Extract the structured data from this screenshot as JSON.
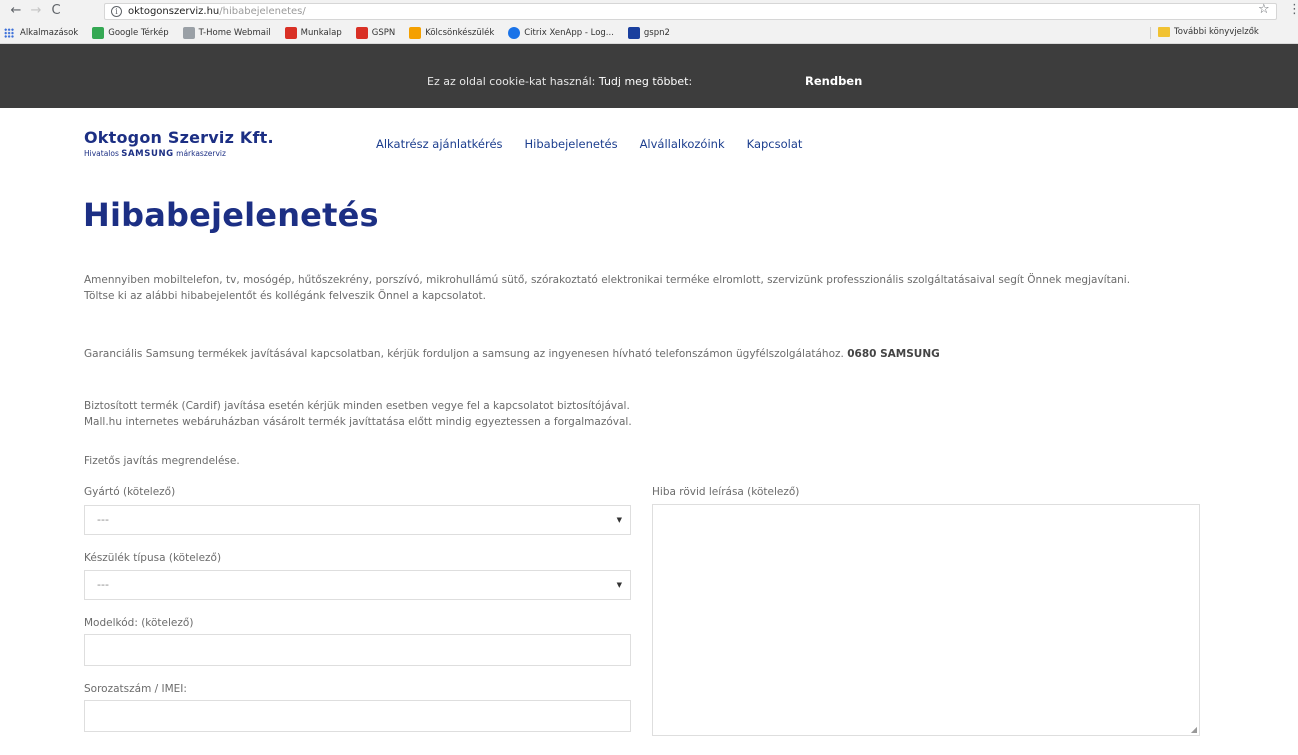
{
  "browser": {
    "back_glyph": "←",
    "forward_glyph": "→",
    "reload_glyph": "C",
    "info_glyph": "i",
    "url_domain": "oktogonszerviz.hu",
    "url_path": "/hibabejelenetes/",
    "star_glyph": "☆",
    "menu_glyph": "⋮",
    "bookmarks": [
      {
        "label": "Alkalmazások",
        "icon": "apps-icon",
        "color": "#3b6fd8"
      },
      {
        "label": "Google Térkép",
        "icon": "maps-icon",
        "color": "#34a853"
      },
      {
        "label": "T-Home Webmail",
        "icon": "thome-icon",
        "color": "#9aa0a6"
      },
      {
        "label": "Munkalap",
        "icon": "munkalap-icon",
        "color": "#d93025"
      },
      {
        "label": "GSPN",
        "icon": "gspn-icon",
        "color": "#d93025"
      },
      {
        "label": "Kölcsönkészülék",
        "icon": "kolcson-icon",
        "color": "#f4a000"
      },
      {
        "label": "Citrix XenApp - Log...",
        "icon": "citrix-icon",
        "color": "#1a73e8"
      },
      {
        "label": "gspn2",
        "icon": "s-icon",
        "color": "#1a3f9e"
      }
    ],
    "more_bookmarks": "További könyvjelzők"
  },
  "cookie_bar": {
    "text": "Ez az oldal cookie-kat használ:",
    "more": "Tudj meg többet",
    "ok": "Rendben"
  },
  "site": {
    "brand_title": "Oktogon Szerviz Kft.",
    "brand_sub_pre": "Hivatalos",
    "brand_sub_brand": "SAMSUNG",
    "brand_sub_post": "márkaszerviz",
    "nav": [
      {
        "label": "Alkatrész ajánlatkérés"
      },
      {
        "label": "Hibabejelenetés"
      },
      {
        "label": "Alvállalkozóink"
      },
      {
        "label": "Kapcsolat"
      }
    ]
  },
  "page": {
    "title": "Hibabejelenetés",
    "intro_1": "Amennyiben mobiltelefon, tv, mosógép, hűtőszekrény, porszívó, mikrohullámú sütő, szórakoztató elektronikai terméke elromlott, szervizünk professzionális szolgáltatásaival segít Önnek megjavítani.",
    "intro_2": "Töltse ki az alábbi hibabejelentőt és kollégánk felveszik Önnel a kapcsolatot.",
    "warranty_text": "Garanciális Samsung termékek javításával kapcsolatban, kérjük forduljon a samsung az ingyenesen hívható telefonszámon ügyfélszolgálatához.",
    "warranty_phone": "0680 SAMSUNG",
    "insured_1": "Biztosított termék (Cardif) javítása esetén kérjük minden esetben vegye fel a kapcsolatot biztosítójával.",
    "insured_2": "Mall.hu internetes webáruházban vásárolt termék javíttatása előtt mindig egyeztessen a forgalmazóval.",
    "paid_repair": "Fizetős javítás megrendelése."
  },
  "form": {
    "manufacturer_label": "Gyártó (kötelező)",
    "manufacturer_value": "---",
    "device_type_label": "Készülék típusa (kötelező)",
    "device_type_value": "---",
    "model_label": "Modelkód: (kötelező)",
    "serial_label": "Sorozatszám / IMEI:",
    "description_label": "Hiba rövid leírása (kötelező)",
    "caret_glyph": "▼",
    "resize_glyph": "◢"
  }
}
